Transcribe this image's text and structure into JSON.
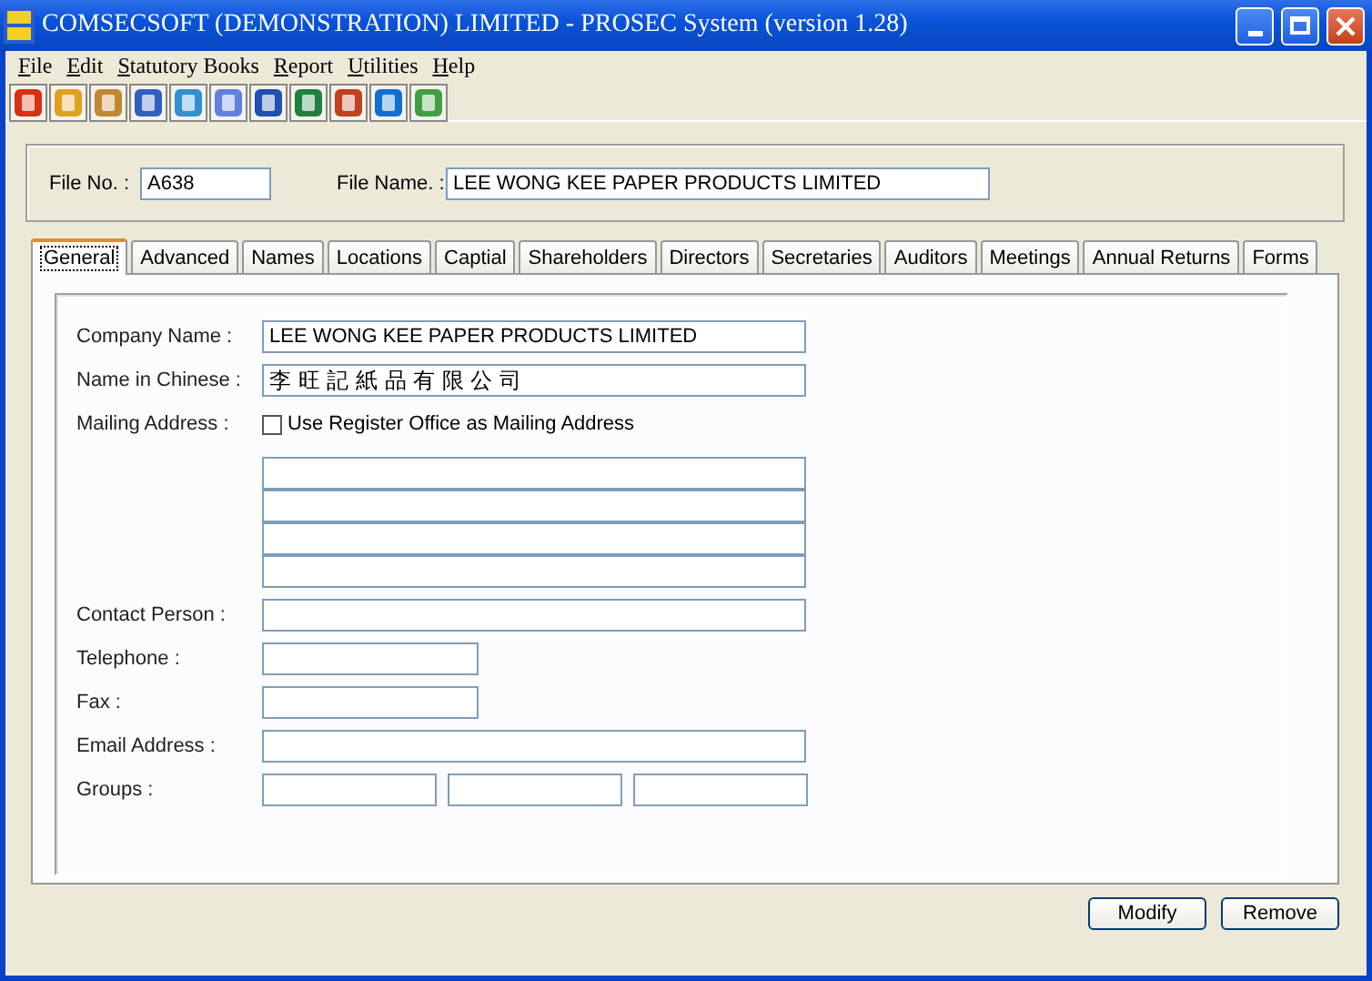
{
  "window": {
    "title": "COMSECSOFT (DEMONSTRATION) LIMITED - PROSEC System (version 1.28)"
  },
  "menu": [
    {
      "label": "File"
    },
    {
      "label": "Edit"
    },
    {
      "label": "Statutory Books"
    },
    {
      "label": "Report"
    },
    {
      "label": "Utilities"
    },
    {
      "label": "Help"
    }
  ],
  "header": {
    "file_no": {
      "label": "File No. :",
      "value": "A638"
    },
    "file_name": {
      "label": "File Name. :",
      "value": "LEE WONG KEE PAPER PRODUCTS LIMITED"
    }
  },
  "tabs": [
    {
      "label": "General",
      "selected": true
    },
    {
      "label": "Advanced",
      "selected": false
    },
    {
      "label": "Names",
      "selected": false
    },
    {
      "label": "Locations",
      "selected": false
    },
    {
      "label": "Captial",
      "selected": false
    },
    {
      "label": "Shareholders",
      "selected": false
    },
    {
      "label": "Directors",
      "selected": false
    },
    {
      "label": "Secretaries",
      "selected": false
    },
    {
      "label": "Auditors",
      "selected": false
    },
    {
      "label": "Meetings",
      "selected": false
    },
    {
      "label": "Annual Returns",
      "selected": false
    },
    {
      "label": "Forms",
      "selected": false
    }
  ],
  "form": [
    {
      "kind": "wide",
      "label": "Company Name :",
      "value": "LEE WONG KEE PAPER PRODUCTS LIMITED"
    },
    {
      "kind": "wide",
      "label": "Name in Chinese :",
      "value": "李 旺 記 紙 品 有 限 公 司"
    },
    {
      "kind": "address",
      "label": "Mailing Address :",
      "checkbox": {
        "label": "Use Register Office as Mailing Address",
        "checked": false
      }
    },
    {
      "kind": "wide",
      "label": "Contact Person :"
    },
    {
      "kind": "short",
      "label": "Telephone :"
    },
    {
      "kind": "short",
      "label": "Fax :"
    },
    {
      "kind": "wide",
      "label": "Email Address :"
    },
    {
      "kind": "triple",
      "label": "Groups :"
    }
  ],
  "buttons": [
    {
      "label": "Modify"
    },
    {
      "label": "Remove"
    }
  ]
}
